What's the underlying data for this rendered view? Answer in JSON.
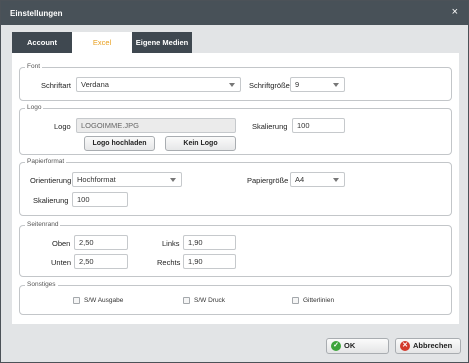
{
  "window": {
    "title": "Einstellungen",
    "close_glyph": "×"
  },
  "tabs": [
    {
      "label": "Account"
    },
    {
      "label": "Excel"
    },
    {
      "label": "Eigene Medien"
    }
  ],
  "font": {
    "legend": "Font",
    "schriftart_label": "Schriftart",
    "schriftart_value": "Verdana",
    "schriftgroesse_label": "Schriftgröße",
    "schriftgroesse_value": "9"
  },
  "logo": {
    "legend": "Logo",
    "logo_label": "Logo",
    "logo_value": "LOGOIMME.JPG",
    "upload_button": "Logo hochladen",
    "no_logo_button": "Kein Logo",
    "skalierung_label": "Skalierung",
    "skalierung_value": "100"
  },
  "papierformat": {
    "legend": "Papierformat",
    "orientierung_label": "Orientierung",
    "orientierung_value": "Hochformat",
    "papiergroesse_label": "Papiergröße",
    "papiergroesse_value": "A4",
    "skalierung_label": "Skalierung",
    "skalierung_value": "100"
  },
  "seitenrand": {
    "legend": "Seitenrand",
    "oben_label": "Oben",
    "oben_value": "2,50",
    "unten_label": "Unten",
    "unten_value": "2,50",
    "links_label": "Links",
    "links_value": "1,90",
    "rechts_label": "Rechts",
    "rechts_value": "1,90"
  },
  "sonstiges": {
    "legend": "Sonstiges",
    "sw_ausgabe": "S/W Ausgabe",
    "sw_druck": "S/W Druck",
    "gitterlinien": "Gitterlinien"
  },
  "footer": {
    "ok_label": "OK",
    "cancel_label": "Abbrechen",
    "ok_glyph": "✓",
    "cancel_glyph": "✕"
  },
  "colors": {
    "titlebar": "#485158",
    "tab_dark": "#3f4850",
    "tab_active_text": "#e8a020",
    "ok_icon": "#3ea43c",
    "cancel_icon": "#d23a2c"
  }
}
